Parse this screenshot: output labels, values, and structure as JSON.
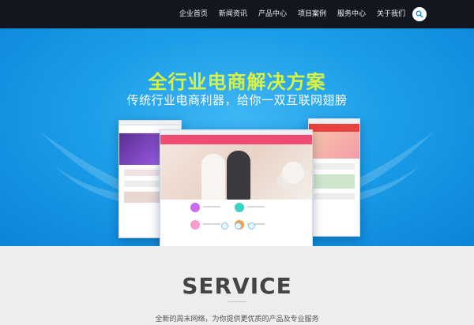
{
  "nav": {
    "items": [
      "企业首页",
      "新闻资讯",
      "产品中心",
      "项目案例",
      "服务中心",
      "关于我们"
    ],
    "search_icon": "search-icon"
  },
  "hero": {
    "title": "全行业电商解决方案",
    "subtitle": "传统行业电商利器，给你一双互联网翅膀",
    "colors": {
      "accent": "#d8f241",
      "background": "#1b9ee8"
    }
  },
  "service": {
    "title": "SERVICE",
    "description": "全新的周末网络，为你提供更优质的产品及专业服务"
  }
}
